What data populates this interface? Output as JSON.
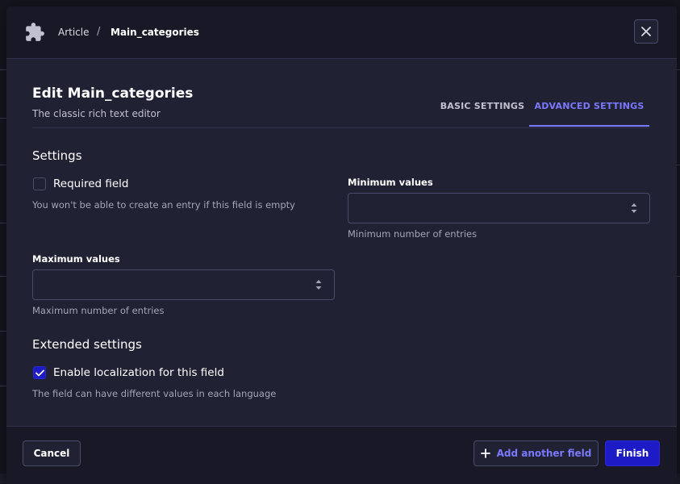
{
  "breadcrumb": {
    "parent": "Article",
    "separator": "/",
    "current": "Main_categories"
  },
  "header": {
    "title": "Edit Main_categories",
    "subtitle": "The classic rich text editor"
  },
  "tabs": [
    {
      "label": "BASIC SETTINGS",
      "active": false
    },
    {
      "label": "ADVANCED SETTINGS",
      "active": true
    }
  ],
  "settings": {
    "title": "Settings",
    "required": {
      "label": "Required field",
      "checked": false,
      "hint": "You won't be able to create an entry if this field is empty"
    },
    "min_values": {
      "label": "Minimum values",
      "value": "",
      "hint": "Minimum number of entries"
    },
    "max_values": {
      "label": "Maximum values",
      "value": "",
      "hint": "Maximum number of entries"
    }
  },
  "extended": {
    "title": "Extended settings",
    "localization": {
      "label": "Enable localization for this field",
      "checked": true,
      "hint": "The field can have different values in each language"
    }
  },
  "footer": {
    "cancel": "Cancel",
    "add_another": "Add another field",
    "finish": "Finish"
  },
  "icons": {
    "header": "puzzle-icon",
    "close": "close-icon",
    "stepper": "stepper-icon",
    "add": "plus-icon",
    "check": "check-icon"
  },
  "colors": {
    "primary": "#7b79ff",
    "primary_button": "#1d1bc5",
    "panel": "#212134",
    "header": "#181826",
    "border": "#4a4a6a"
  }
}
